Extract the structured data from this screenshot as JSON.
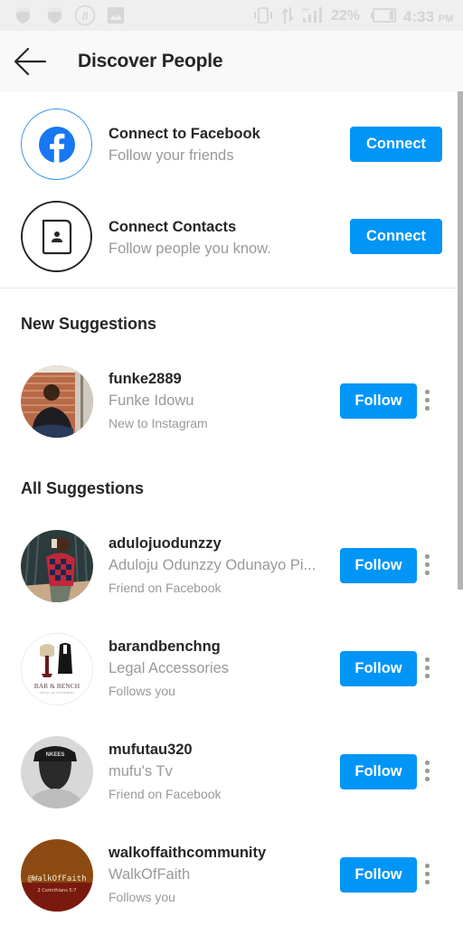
{
  "status_bar": {
    "icons": [
      "shield-icon",
      "shield-icon",
      "b-badge-icon",
      "image-icon",
      "vibrate-icon",
      "data-arrows-icon",
      "signal-icon",
      "battery-icon"
    ],
    "network_label": "H+",
    "battery": "22%",
    "time": "4:33",
    "ampm": "PM"
  },
  "header": {
    "back_icon": "arrow-left-icon",
    "title": "Discover People"
  },
  "connect": [
    {
      "icon": "facebook-icon",
      "title": "Connect to Facebook",
      "subtitle": "Follow your friends",
      "button": "Connect",
      "accent": "#1877f2"
    },
    {
      "icon": "contact-book-icon",
      "title": "Connect Contacts",
      "subtitle": "Follow people you know.",
      "button": "Connect"
    }
  ],
  "sections": {
    "new": "New Suggestions",
    "all": "All Suggestions"
  },
  "new_suggestions": [
    {
      "username": "funke2889",
      "name": "Funke Idowu",
      "reason": "New to Instagram",
      "button": "Follow"
    }
  ],
  "all_suggestions": [
    {
      "username": "adulojuodunzzy",
      "name": "Aduloju Odunzzy Odunayo Pi...",
      "reason": "Friend on Facebook",
      "button": "Follow"
    },
    {
      "username": "barandbenchng",
      "name": "Legal Accessories",
      "reason": "Follows you",
      "button": "Follow",
      "avatar_text": "BAR & BENCH",
      "avatar_subtext": "LEGAL ACCESSORIES"
    },
    {
      "username": "mufutau320",
      "name": "mufu's Tv",
      "reason": "Friend on Facebook",
      "button": "Follow"
    },
    {
      "username": "walkoffaithcommunity",
      "name": "WalkOfFaith",
      "reason": "Follows you",
      "button": "Follow",
      "avatar_text": "@WalkOfFaith",
      "avatar_subtext": "2 Corinthians 5:7"
    }
  ],
  "colors": {
    "primary_button": "#0095f6",
    "facebook_blue": "#1877f2",
    "secondary_text": "#999999",
    "primary_text": "#262626"
  }
}
